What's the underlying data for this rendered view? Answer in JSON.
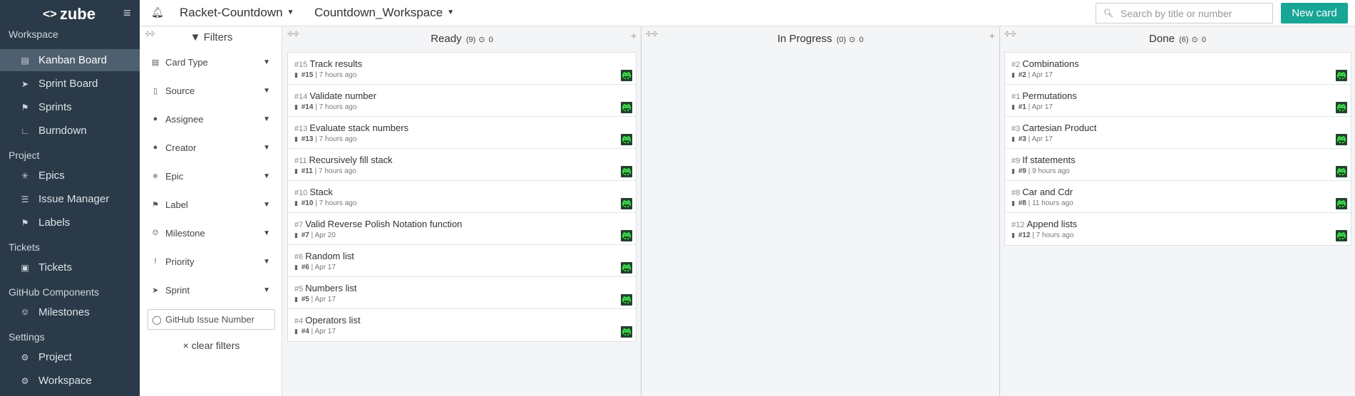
{
  "app": {
    "logo": "zube"
  },
  "sidebar": {
    "sections": [
      {
        "heading": "Workspace",
        "items": [
          {
            "label": "Kanban Board",
            "icon": "kanban-icon",
            "active": true
          },
          {
            "label": "Sprint Board",
            "icon": "rocket-icon",
            "active": false
          },
          {
            "label": "Sprints",
            "icon": "flag-icon",
            "active": false
          },
          {
            "label": "Burndown",
            "icon": "chart-icon",
            "active": false
          }
        ]
      },
      {
        "heading": "Project",
        "items": [
          {
            "label": "Epics",
            "icon": "epic-icon",
            "active": false
          },
          {
            "label": "Issue Manager",
            "icon": "list-icon",
            "active": false
          },
          {
            "label": "Labels",
            "icon": "tag-icon",
            "active": false
          }
        ]
      },
      {
        "heading": "Tickets",
        "items": [
          {
            "label": "Tickets",
            "icon": "ticket-icon",
            "active": false
          }
        ]
      },
      {
        "heading": "GitHub Components",
        "items": [
          {
            "label": "Milestones",
            "icon": "milestone-icon",
            "active": false
          }
        ]
      },
      {
        "heading": "Settings",
        "items": [
          {
            "label": "Project",
            "icon": "gear-icon",
            "active": false
          },
          {
            "label": "Workspace",
            "icon": "gear-icon",
            "active": false
          }
        ]
      }
    ]
  },
  "topbar": {
    "project": "Racket-Countdown",
    "workspace": "Countdown_Workspace",
    "search_placeholder": "Search by title or number",
    "new_card_label": "New card"
  },
  "filters": {
    "title": "Filters",
    "items": [
      {
        "label": "Card Type",
        "icon": "card-type-icon"
      },
      {
        "label": "Source",
        "icon": "source-icon"
      },
      {
        "label": "Assignee",
        "icon": "user-icon"
      },
      {
        "label": "Creator",
        "icon": "creator-icon"
      },
      {
        "label": "Epic",
        "icon": "epic-icon"
      },
      {
        "label": "Label",
        "icon": "tag-icon"
      },
      {
        "label": "Milestone",
        "icon": "milestone-icon"
      },
      {
        "label": "Priority",
        "icon": "priority-icon"
      },
      {
        "label": "Sprint",
        "icon": "rocket-icon"
      }
    ],
    "github_placeholder": "GitHub Issue Number",
    "clear_label": "clear filters"
  },
  "columns": [
    {
      "name": "Ready",
      "count": "(9)",
      "points": "0",
      "cards": [
        {
          "num": "#15",
          "title": "Track results",
          "time": "7 hours ago"
        },
        {
          "num": "#14",
          "title": "Validate number",
          "time": "7 hours ago"
        },
        {
          "num": "#13",
          "title": "Evaluate stack numbers",
          "time": "7 hours ago"
        },
        {
          "num": "#11",
          "title": "Recursively fill stack",
          "time": "7 hours ago"
        },
        {
          "num": "#10",
          "title": "Stack",
          "time": "7 hours ago"
        },
        {
          "num": "#7",
          "title": "Valid Reverse Polish Notation function",
          "time": "Apr 20"
        },
        {
          "num": "#6",
          "title": "Random list",
          "time": "Apr 17"
        },
        {
          "num": "#5",
          "title": "Numbers list",
          "time": "Apr 17"
        },
        {
          "num": "#4",
          "title": "Operators list",
          "time": "Apr 17"
        }
      ]
    },
    {
      "name": "In Progress",
      "count": "(0)",
      "points": "0",
      "cards": []
    },
    {
      "name": "Done",
      "count": "(6)",
      "points": "0",
      "cards": [
        {
          "num": "#2",
          "title": "Combinations",
          "time": "Apr 17"
        },
        {
          "num": "#1",
          "title": "Permutations",
          "time": "Apr 17"
        },
        {
          "num": "#3",
          "title": "Cartesian Product",
          "time": "Apr 17"
        },
        {
          "num": "#9",
          "title": "If statements",
          "time": "9 hours ago"
        },
        {
          "num": "#8",
          "title": "Car and Cdr",
          "time": "11 hours ago"
        },
        {
          "num": "#12",
          "title": "Append lists",
          "time": "7 hours ago"
        }
      ]
    }
  ],
  "colors": {
    "sidebar_bg": "#2b3a48",
    "accent": "#17a596",
    "avatar_bg": "#23432a",
    "avatar_fg": "#3bd24a"
  }
}
